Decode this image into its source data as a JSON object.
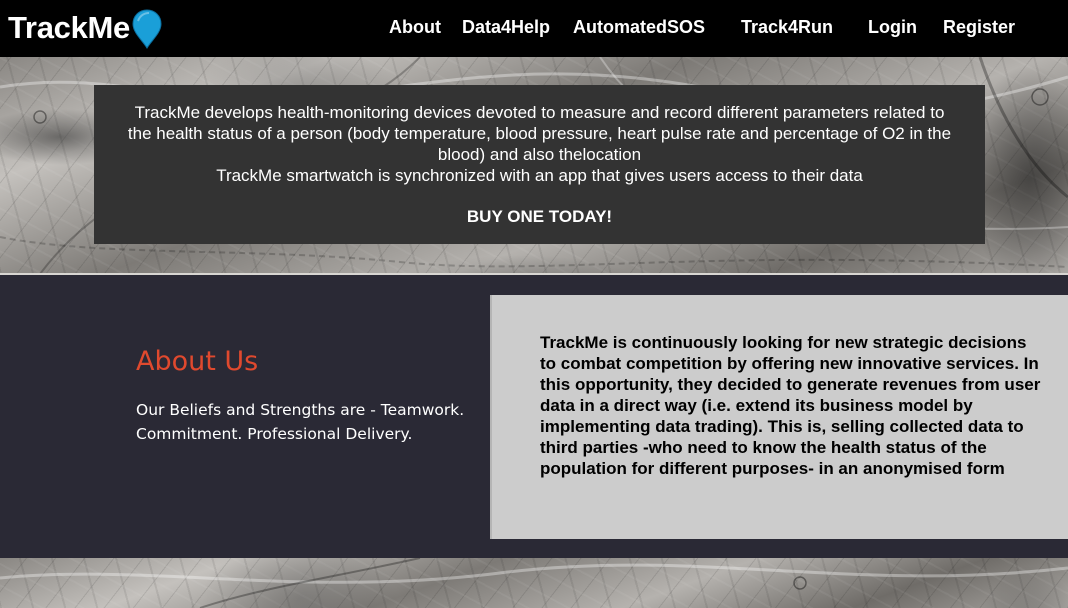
{
  "header": {
    "brand": "TrackMe",
    "nav": [
      {
        "label": "About"
      },
      {
        "label": "Data4Help"
      },
      {
        "label": "AutomatedSOS"
      },
      {
        "label": "Track4Run"
      },
      {
        "label": "Login"
      },
      {
        "label": "Register"
      }
    ]
  },
  "intro": {
    "paragraph1": "TrackMe develops health-monitoring devices devoted to measure and record different parameters related to the health status of a person (body temperature, blood pressure, heart pulse rate and percentage of O2 in the blood) and also thelocation",
    "paragraph2": "TrackMe smartwatch is synchronized with an app that gives users access to their data",
    "cta": "BUY ONE TODAY!"
  },
  "about": {
    "title": "About Us",
    "text": "Our Beliefs and Strengths are - Teamwork. Commitment. Professional Delivery.",
    "panel_text": "TrackMe is continuously looking for new strategic decisions to combat competition by offering new innovative services. In this opportunity, they decided to generate revenues from user data in a direct way (i.e. extend its business model by implementing data trading). This is, selling collected data to third parties -who need to know the health status of the population for different purposes- in an anonymised form"
  },
  "colors": {
    "header_bg": "#000000",
    "pin": "#1a9fd8",
    "intro_bg": "#333333",
    "about_bg": "#2a2935",
    "about_title": "#e0492e",
    "panel_bg": "#cccccc"
  },
  "icons": {
    "brand_pin": "map-pin-icon"
  }
}
